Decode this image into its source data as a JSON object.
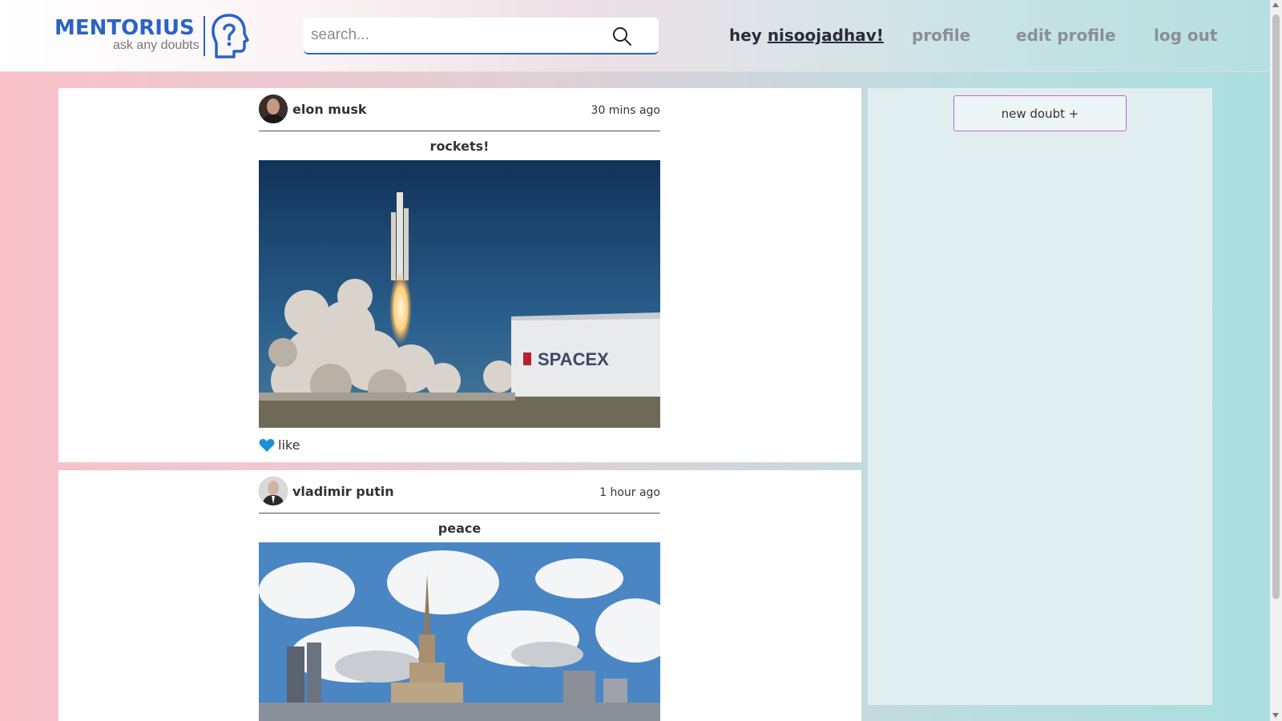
{
  "header": {
    "logo_word": "MENTORIUS",
    "logo_tagline": "ask any doubts",
    "logo_icon": "head-question-icon",
    "search_placeholder": "search...",
    "search_icon": "search-icon",
    "greeting_prefix": "hey ",
    "username": "nisoojadhav!",
    "nav": {
      "profile": "profile",
      "edit_profile": "edit profile",
      "log_out": "log out"
    }
  },
  "posts": [
    {
      "author": "elon musk",
      "time": "30 mins ago",
      "title": "rockets!",
      "like_label": "like",
      "like_icon": "heart-icon"
    },
    {
      "author": "vladimir putin",
      "time": "1 hour ago",
      "title": "peace"
    }
  ],
  "sidebar": {
    "new_doubt_label": "new doubt +"
  },
  "colors": {
    "brand": "#2a63c7",
    "new_doubt_border": "#c462d6",
    "heart": "#1f8fd6"
  }
}
